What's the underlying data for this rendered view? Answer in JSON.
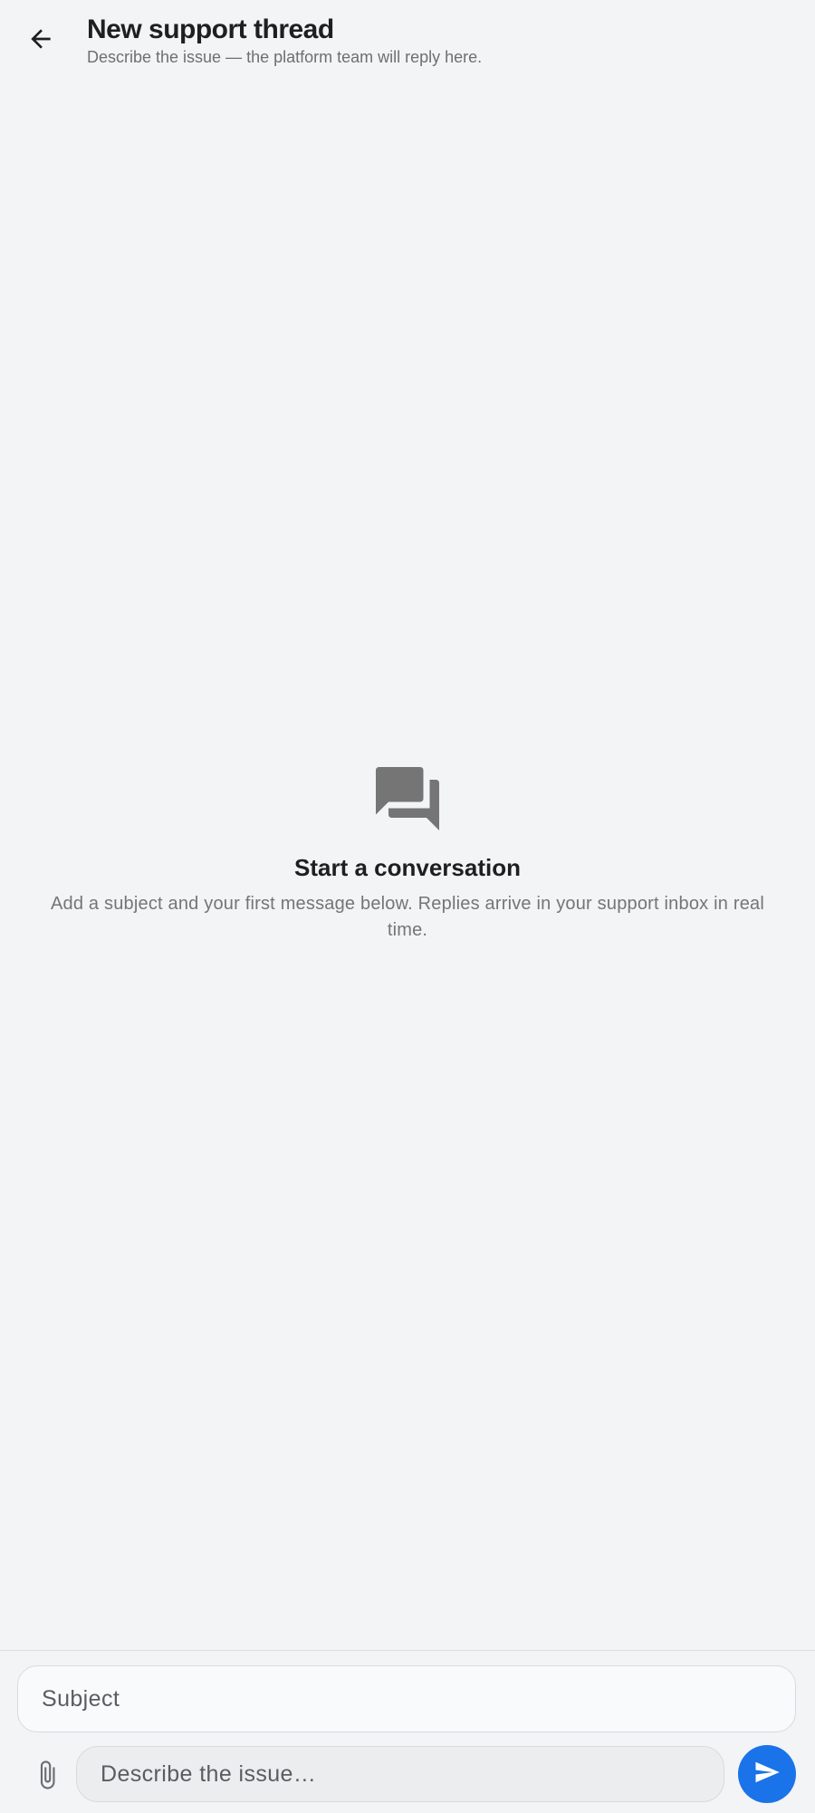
{
  "header": {
    "title": "New support thread",
    "subtitle": "Describe the issue — the platform team will reply here.",
    "back_icon": "arrow-back-icon"
  },
  "empty_state": {
    "icon": "forum-icon",
    "title": "Start a conversation",
    "body": "Add a subject and your first message below. Replies arrive in your support inbox in real time."
  },
  "composer": {
    "subject_placeholder": "Subject",
    "subject_value": "",
    "message_placeholder": "Describe the issue…",
    "message_value": "",
    "attach_icon": "paperclip-icon",
    "send_icon": "send-icon"
  },
  "colors": {
    "background": "#f3f4f6",
    "accent": "#1a73e8",
    "icon_gray": "#757575"
  }
}
